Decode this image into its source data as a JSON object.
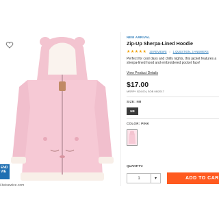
{
  "product": {
    "badge": "NEW ARRIVAL",
    "title": "Zip-Up Sherpa-Lined Hoodie",
    "rating_stars": "★★★★★",
    "reviews_link": "20 REVIEWS",
    "qa_link": "1 QUESTION, 3 ANSWERS",
    "description": "Perfect for cool days and chilly nights, this jacket features a sherpa-lined hood and embroidered pocket face!",
    "details_link": "View Product Details",
    "price": "$17.00",
    "msrp": "MSRP*: $24.00  |  SOB 08/2017"
  },
  "size": {
    "label": "SIZE: NB",
    "selected": "NB"
  },
  "color": {
    "label": "COLOR: PINK"
  },
  "quantity": {
    "label": "QUANTITY:",
    "value": "1",
    "dropdown_icon": "chevron-down-icon"
  },
  "cart": {
    "add_label": "ADD TO CAR"
  },
  "side_tab": {
    "label": "END\nVIE"
  },
  "footer": {
    "url": "i.beisewice.com"
  },
  "colors": {
    "accent": "#ff5a1f",
    "link": "#2a7ab8",
    "jacket": "#f6c9d5"
  }
}
